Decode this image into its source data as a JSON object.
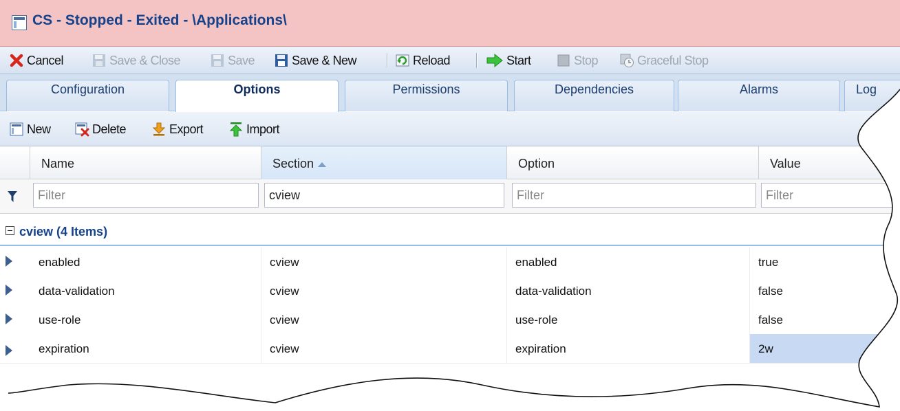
{
  "window": {
    "title": "CS - Stopped - Exited - \\Applications\\"
  },
  "toolbar": {
    "cancel": "Cancel",
    "save_close": "Save & Close",
    "save": "Save",
    "save_new": "Save & New",
    "reload": "Reload",
    "start": "Start",
    "stop": "Stop",
    "graceful_stop": "Graceful Stop"
  },
  "tabs": [
    "Configuration",
    "Options",
    "Permissions",
    "Dependencies",
    "Alarms",
    "Log"
  ],
  "grid_toolbar": {
    "new": "New",
    "delete": "Delete",
    "export": "Export",
    "import": "Import"
  },
  "columns": {
    "name": "Name",
    "section": "Section",
    "option": "Option",
    "value": "Value"
  },
  "filters": {
    "name": {
      "value": "",
      "placeholder": "Filter"
    },
    "section": {
      "value": "cview",
      "placeholder": "Filter"
    },
    "option": {
      "value": "",
      "placeholder": "Filter"
    },
    "value": {
      "value": "",
      "placeholder": "Filter"
    }
  },
  "group": {
    "label": "cview (4 Items)"
  },
  "rows": [
    {
      "name": "enabled",
      "section": "cview",
      "option": "enabled",
      "value": "true"
    },
    {
      "name": "data-validation",
      "section": "cview",
      "option": "data-validation",
      "value": "false"
    },
    {
      "name": "use-role",
      "section": "cview",
      "option": "use-role",
      "value": "false"
    },
    {
      "name": "expiration",
      "section": "cview",
      "option": "expiration",
      "value": "2w"
    }
  ],
  "colors": {
    "title_bg": "#f4c4c4",
    "title_text": "#15428b",
    "selected_cell": "#c7d9f3",
    "tab_border": "#99bbe8"
  }
}
